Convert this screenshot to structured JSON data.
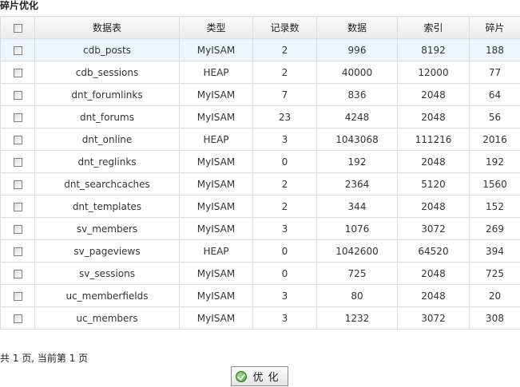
{
  "page": {
    "title": "碎片优化"
  },
  "table": {
    "headers": {
      "name": "数据表",
      "type": "类型",
      "records": "记录数",
      "data": "数据",
      "index": "索引",
      "fragment": "碎片"
    },
    "rows": [
      {
        "name": "cdb_posts",
        "type": "MyISAM",
        "records": "2",
        "data": "996",
        "index": "8192",
        "fragment": "188"
      },
      {
        "name": "cdb_sessions",
        "type": "HEAP",
        "records": "2",
        "data": "40000",
        "index": "12000",
        "fragment": "77"
      },
      {
        "name": "dnt_forumlinks",
        "type": "MyISAM",
        "records": "7",
        "data": "836",
        "index": "2048",
        "fragment": "64"
      },
      {
        "name": "dnt_forums",
        "type": "MyISAM",
        "records": "23",
        "data": "4248",
        "index": "2048",
        "fragment": "56"
      },
      {
        "name": "dnt_online",
        "type": "HEAP",
        "records": "3",
        "data": "1043068",
        "index": "111216",
        "fragment": "2016"
      },
      {
        "name": "dnt_reglinks",
        "type": "MyISAM",
        "records": "0",
        "data": "192",
        "index": "2048",
        "fragment": "192"
      },
      {
        "name": "dnt_searchcaches",
        "type": "MyISAM",
        "records": "2",
        "data": "2364",
        "index": "5120",
        "fragment": "1560"
      },
      {
        "name": "dnt_templates",
        "type": "MyISAM",
        "records": "2",
        "data": "344",
        "index": "2048",
        "fragment": "152"
      },
      {
        "name": "sv_members",
        "type": "MyISAM",
        "records": "3",
        "data": "1076",
        "index": "3072",
        "fragment": "269"
      },
      {
        "name": "sv_pageviews",
        "type": "HEAP",
        "records": "0",
        "data": "1042600",
        "index": "64520",
        "fragment": "394"
      },
      {
        "name": "sv_sessions",
        "type": "MyISAM",
        "records": "0",
        "data": "725",
        "index": "2048",
        "fragment": "725"
      },
      {
        "name": "uc_memberfields",
        "type": "MyISAM",
        "records": "3",
        "data": "80",
        "index": "2048",
        "fragment": "20"
      },
      {
        "name": "uc_members",
        "type": "MyISAM",
        "records": "3",
        "data": "1232",
        "index": "3072",
        "fragment": "308"
      }
    ]
  },
  "pager": {
    "text": "共 1 页, 当前第 1 页"
  },
  "optimize_button": {
    "label": "优化",
    "icon": "ok-icon"
  }
}
